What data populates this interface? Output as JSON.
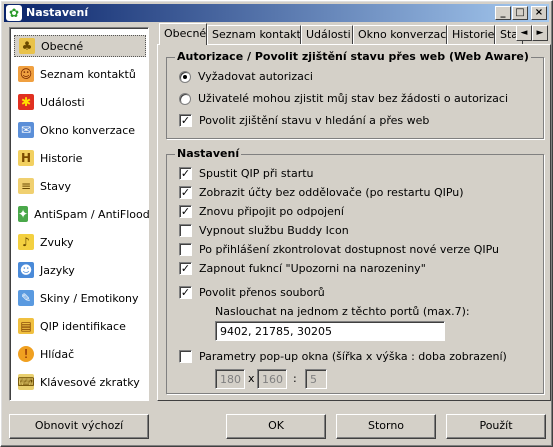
{
  "window": {
    "title": "Nastavení",
    "app_icon": "qip-flower-icon",
    "min_button": "_",
    "max_button": "□",
    "close_button": "×"
  },
  "sidebar": {
    "items": [
      {
        "label": "Obecné",
        "icon": "settings-icon"
      },
      {
        "label": "Seznam kontaktů",
        "icon": "contacts-icon"
      },
      {
        "label": "Události",
        "icon": "events-icon"
      },
      {
        "label": "Okno konverzace",
        "icon": "chat-window-icon"
      },
      {
        "label": "Historie",
        "icon": "history-icon"
      },
      {
        "label": "Stavy",
        "icon": "status-icon"
      },
      {
        "label": "AntiSpam / AntiFlood",
        "icon": "antispam-icon"
      },
      {
        "label": "Zvuky",
        "icon": "sound-icon"
      },
      {
        "label": "Jazyky",
        "icon": "language-icon"
      },
      {
        "label": "Skiny / Emotikony",
        "icon": "skins-icon"
      },
      {
        "label": "QIP identifikace",
        "icon": "qip-id-icon"
      },
      {
        "label": "Hlídač",
        "icon": "watcher-icon"
      },
      {
        "label": "Klávesové zkratky",
        "icon": "hotkeys-icon"
      }
    ]
  },
  "tabs": {
    "items": [
      "Obecné",
      "Seznam kontaktů",
      "Události",
      "Okno konverzace",
      "Historie",
      "Sta"
    ],
    "scroll_left": "◄",
    "scroll_right": "►"
  },
  "auth_group": {
    "title": "Autorizace / Povolit zjištění stavu přes web (Web Aware)",
    "radio_require": "Vyžadovat autorizaci",
    "radio_anyone": "Uživatelé mohou zjistit můj stav bez žádosti o autorizaci",
    "check_web_search": "Povolit zjištění stavu v hledání a přes web"
  },
  "settings_group": {
    "title": "Nastavení",
    "check_autostart": "Spustit QIP při startu",
    "check_separators": "Zobrazit účty bez oddělovače (po restartu QIPu)",
    "check_reconnect": "Znovu připojit po odpojení",
    "check_buddy_icon": "Vypnout službu Buddy Icon",
    "check_new_version": "Po přihlášení zkontrolovat dostupnost nové verze QIPu",
    "check_birthday": "Zapnout fukncí \"Upozorni na narozeniny\"",
    "check_file_transfer": "Povolit přenos souborů",
    "ports_label": "Naslouchat na jednom z těchto portů (max.7):",
    "ports_value": "9402, 21785, 30205",
    "check_popup": "Parametry pop-up okna (šířka x výška : doba zobrazení)",
    "popup_width": "180",
    "popup_x": "x",
    "popup_height": "160",
    "popup_colon": ":",
    "popup_time": "5"
  },
  "checkmark": "✓",
  "buttons": {
    "reset": "Obnovit výchozí",
    "ok": "OK",
    "cancel": "Storno",
    "apply": "Použít"
  },
  "colors": {
    "titlebar_start": "#0a246a",
    "titlebar_end": "#a6caf0",
    "face": "#d4d0c8"
  }
}
